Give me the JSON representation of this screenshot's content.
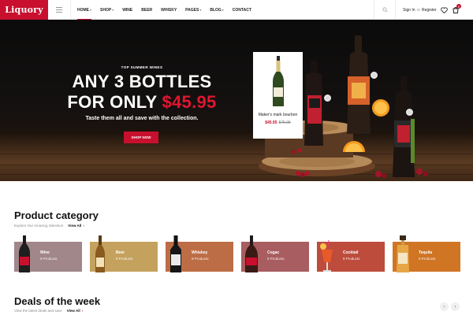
{
  "header": {
    "logo": "Liquory",
    "nav": [
      {
        "label": "HOME",
        "has_caret": true,
        "active": true
      },
      {
        "label": "SHOP",
        "has_caret": true,
        "active": false
      },
      {
        "label": "WINE",
        "has_caret": false,
        "active": false
      },
      {
        "label": "BEER",
        "has_caret": false,
        "active": false
      },
      {
        "label": "WHISKY",
        "has_caret": false,
        "active": false
      },
      {
        "label": "PAGES",
        "has_caret": true,
        "active": false
      },
      {
        "label": "BLOG",
        "has_caret": true,
        "active": false
      },
      {
        "label": "CONTACT",
        "has_caret": false,
        "active": false
      }
    ],
    "sign_in": "Sign In",
    "or": "or",
    "register": "Register",
    "icons": {
      "search": "search-icon",
      "wishlist": "heart-icon",
      "cart": "cart-icon",
      "menu": "hamburger-icon"
    },
    "cart_count": "0"
  },
  "hero": {
    "kicker": "TOP SUMMER WINES",
    "line1": "ANY 3 BOTTLES",
    "line2_prefix": "FOR ONLY ",
    "line2_price": "$45.95",
    "subtitle": "Taste them all and save with the collection.",
    "button": "SHOP NOW",
    "product": {
      "name": "Maker's mark bourbon",
      "price": "$45.95",
      "old_price": "$75.95"
    }
  },
  "category_section": {
    "title": "Product category",
    "subtitle": "Explore Our Amazing Selection",
    "view_all": "View All",
    "items": [
      {
        "name": "Wine",
        "count": "9 Products",
        "color": "#a1868a"
      },
      {
        "name": "Beer",
        "count": "9 Products",
        "color": "#c4a25e"
      },
      {
        "name": "Whiskey",
        "count": "9 Products",
        "color": "#bd6d45"
      },
      {
        "name": "Cogac",
        "count": "9 Products",
        "color": "#a85d60"
      },
      {
        "name": "Cocktail",
        "count": "9 Products",
        "color": "#bd4c3c"
      },
      {
        "name": "Tequila",
        "count": "9 Products",
        "color": "#d07524"
      }
    ]
  },
  "deals_section": {
    "title": "Deals of the week",
    "subtitle": "View the latest deals and save",
    "view_all": "View All"
  },
  "colors": {
    "brand": "#c8102e"
  }
}
